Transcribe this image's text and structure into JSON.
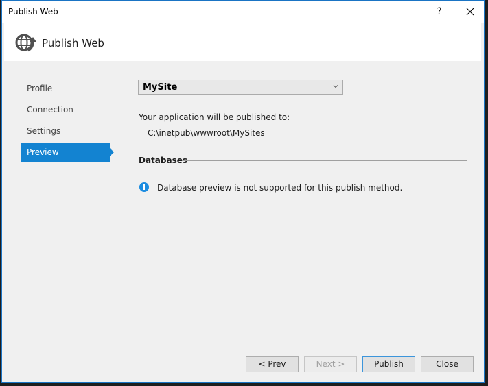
{
  "window": {
    "title": "Publish Web",
    "help_label": "?",
    "accent_color": "#1383d1"
  },
  "header": {
    "title": "Publish Web",
    "icon": "globe-publish-icon"
  },
  "nav": {
    "items": [
      {
        "label": "Profile",
        "active": false
      },
      {
        "label": "Connection",
        "active": false
      },
      {
        "label": "Settings",
        "active": false
      },
      {
        "label": "Preview",
        "active": true
      }
    ]
  },
  "main": {
    "profile_select": {
      "value": "MySite"
    },
    "publish_label": "Your application will be published to:",
    "publish_path": "C:\\inetpub\\wwwroot\\MySites",
    "databases_heading": "Databases",
    "info_message": "Database preview is not supported for this publish method."
  },
  "footer": {
    "prev_label": "< Prev",
    "next_label": "Next >",
    "publish_label": "Publish",
    "close_label": "Close"
  }
}
